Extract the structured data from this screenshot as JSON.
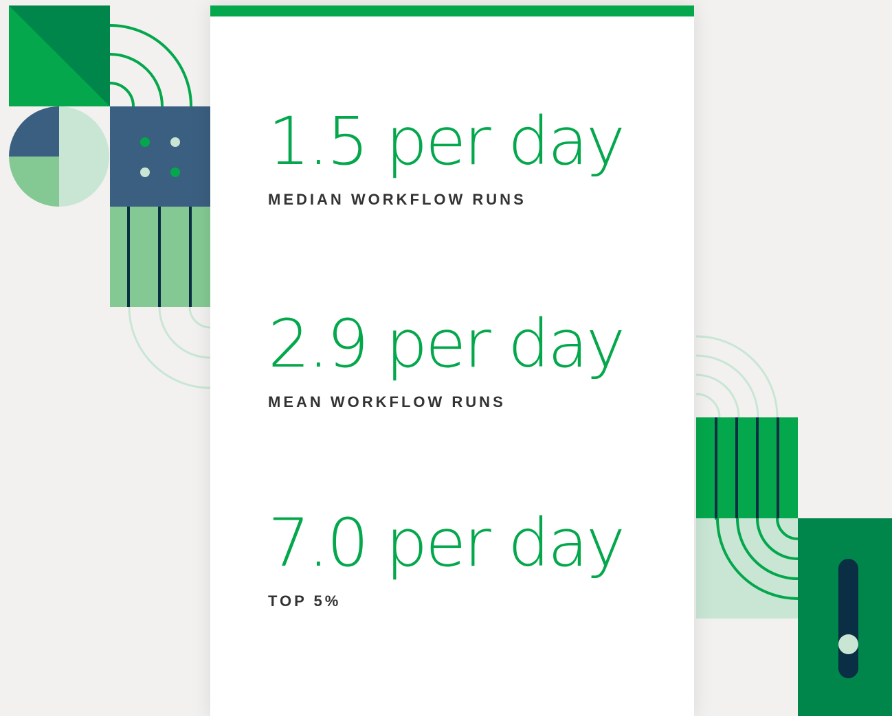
{
  "colors": {
    "background": "#f2f1f0",
    "card": "#ffffff",
    "accent": "#04a74c",
    "dark_green": "#00854a",
    "mid_green": "#84c993",
    "light_green": "#c9e6d5",
    "slate_blue": "#3b5f80",
    "navy": "#0a2e43",
    "label_text": "#333333"
  },
  "stats": [
    {
      "value": "1.5 per day",
      "label": "MEDIAN WORKFLOW RUNS"
    },
    {
      "value": "2.9 per day",
      "label": "MEAN WORKFLOW RUNS"
    },
    {
      "value": "7.0 per day",
      "label": "TOP 5%"
    }
  ],
  "slider": {
    "level": 0.24
  }
}
